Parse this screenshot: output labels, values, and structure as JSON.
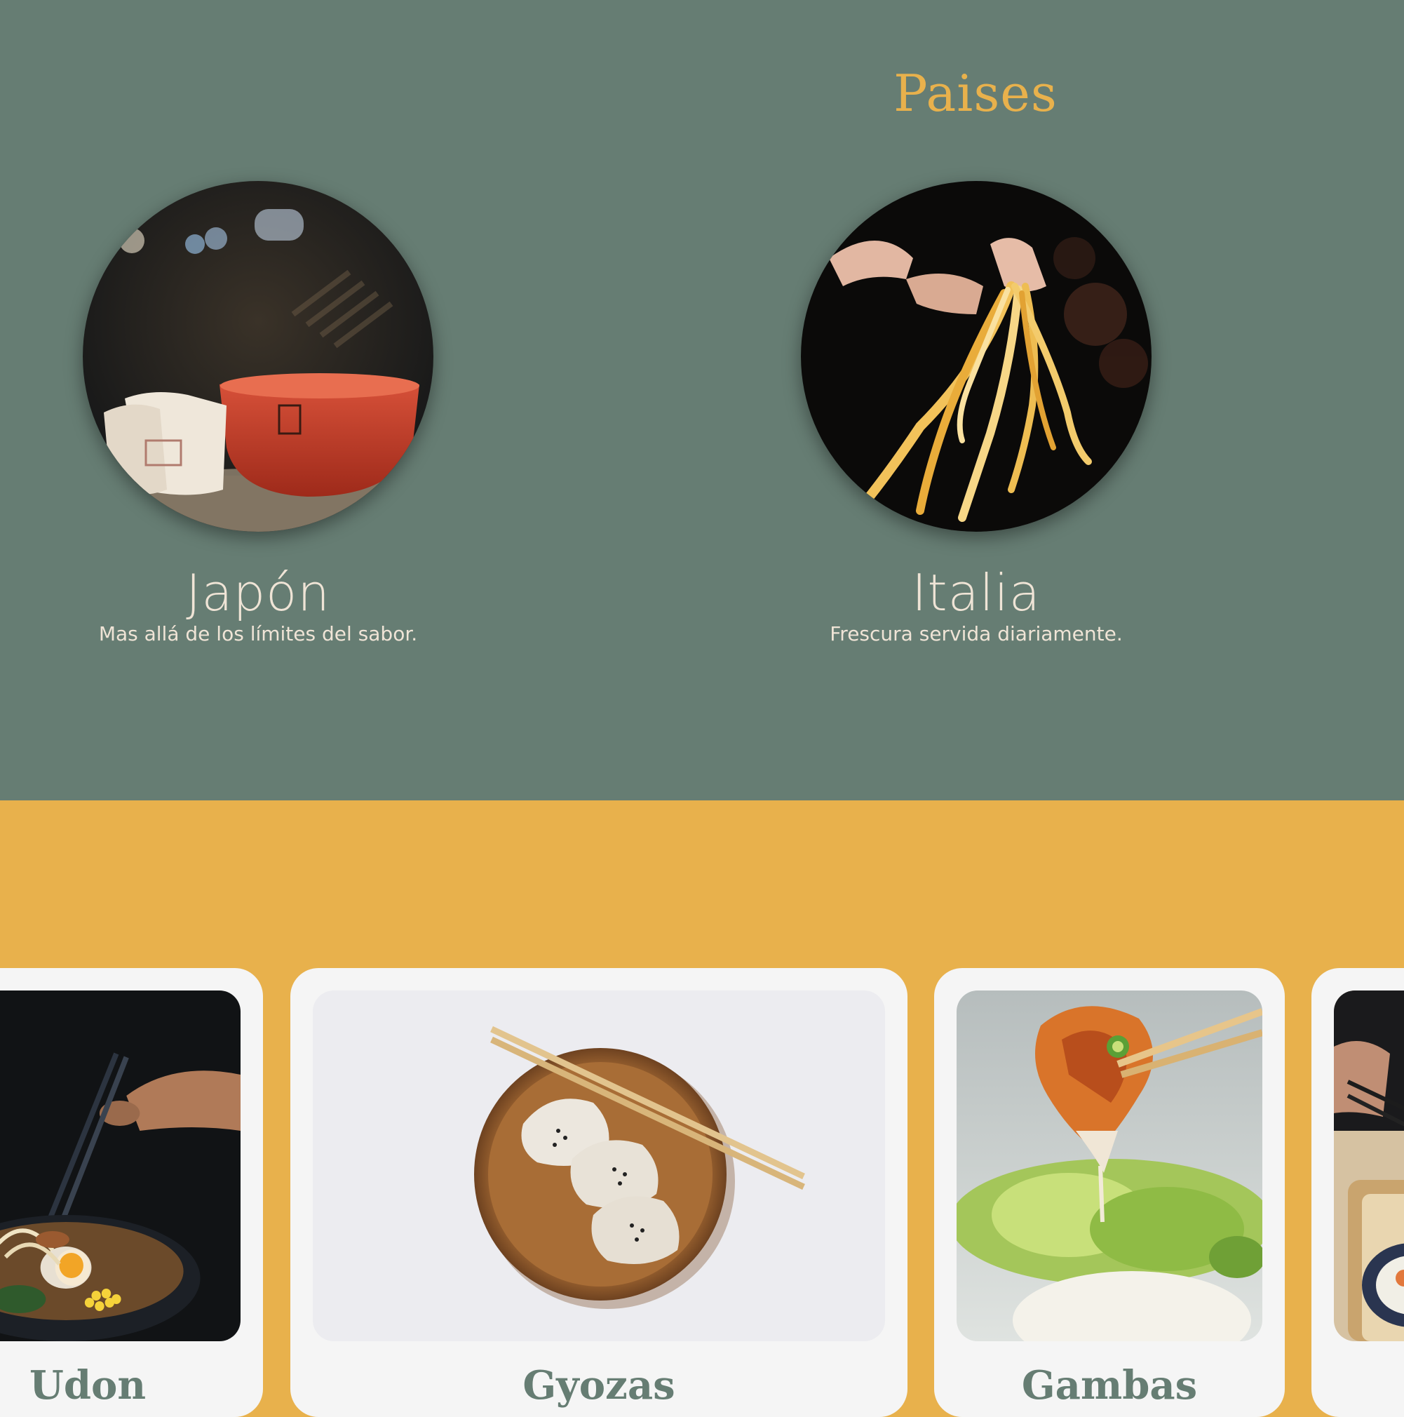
{
  "colors": {
    "sage": "#667D73",
    "mustard": "#E8B14C",
    "cream": "#EFE4D6",
    "card": "#F5F5F5"
  },
  "countries": {
    "title": "Paises",
    "items": [
      {
        "name": "Japón",
        "tagline": "Mas allá de los límites del sabor.",
        "image": "japanese-tea-bowls"
      },
      {
        "name": "Italia",
        "tagline": "Frescura servida diariamente.",
        "image": "fresh-pasta-hands"
      }
    ]
  },
  "dishes": {
    "items": [
      {
        "name": "Udon",
        "image": "udon-bowl-chopsticks"
      },
      {
        "name": "Gyozas",
        "image": "gyoza-wooden-plate"
      },
      {
        "name": "Gambas",
        "image": "shrimp-salad"
      },
      {
        "name": "",
        "image": "sushi-tray"
      }
    ]
  }
}
